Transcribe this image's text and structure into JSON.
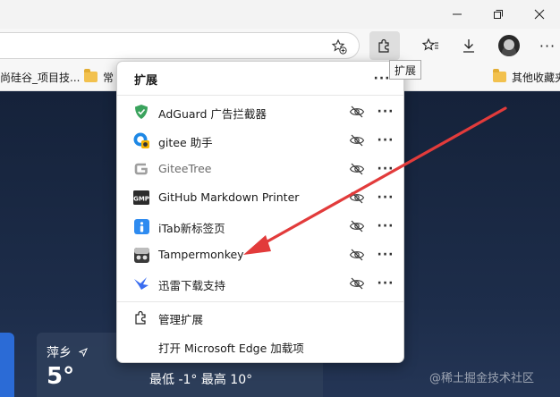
{
  "browser": {
    "window_controls": [
      "minimize",
      "maximize",
      "close"
    ],
    "toolbar_tooltip": "扩展"
  },
  "favorites_bar": {
    "items": [
      {
        "label": "尚硅谷_项目技...",
        "has_folder_icon": false
      },
      {
        "label": "常",
        "has_folder_icon": true
      },
      {
        "label": "其他收藏夹",
        "has_folder_icon": true
      }
    ]
  },
  "extensions_popup": {
    "title": "扩展",
    "items": [
      {
        "name": "AdGuard 广告拦截器",
        "icon": "adguard-shield-icon",
        "icon_color": "#3aa35d",
        "enabled": true
      },
      {
        "name": "gitee 助手",
        "icon": "gitee-helper-icon",
        "icon_color": "#1e88e5",
        "enabled": true
      },
      {
        "name": "GiteeTree",
        "icon": "giteetree-g-icon",
        "icon_color": "#9e9e9e",
        "enabled": false
      },
      {
        "name": "GitHub Markdown Printer",
        "icon": "gmp-icon",
        "icon_color": "#2b2b2b",
        "enabled": true
      },
      {
        "name": "iTab新标签页",
        "icon": "itab-icon",
        "icon_color": "#2e8bf0",
        "enabled": true
      },
      {
        "name": "Tampermonkey",
        "icon": "tampermonkey-icon",
        "icon_color": "#1f1f1f",
        "enabled": true
      },
      {
        "name": "迅雷下载支持",
        "icon": "xunlei-bird-icon",
        "icon_color": "#3a6df0",
        "enabled": true
      }
    ],
    "footer": {
      "manage_label": "管理扩展",
      "open_addons_label": "打开 Microsoft Edge 加载项"
    }
  },
  "weather": {
    "city": "萍乡",
    "temperature": "5°",
    "range_text": "最低 -1° 最高 10°"
  },
  "watermark": "@稀土掘金技术社区",
  "colors": {
    "annotation_arrow": "#e23b3b",
    "page_background": "#1b2a44",
    "weather_accent": "#2b6bd6"
  }
}
